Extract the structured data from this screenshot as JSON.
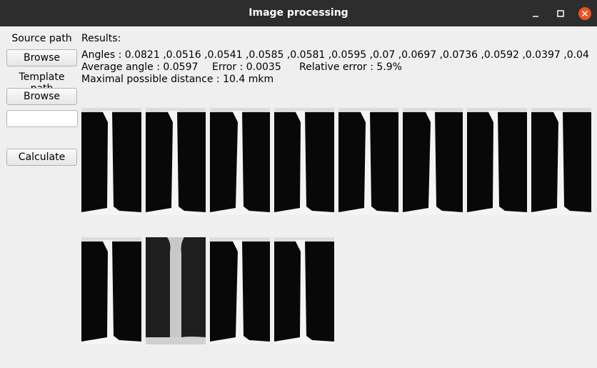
{
  "window": {
    "title": "Image processing",
    "controls": [
      "minimize-icon",
      "maximize-icon",
      "close-icon"
    ],
    "close_color": "#e95420"
  },
  "sidebar": {
    "source_label": "Source path",
    "source_button": "Browse",
    "template_label": "Template path",
    "template_button": "Browse",
    "path_value": "",
    "calculate_button": "Calculate"
  },
  "results": {
    "heading": "Results:",
    "angles": "Angles : 0.0821 ,0.0516 ,0.0541 ,0.0585 ,0.0581 ,0.0595 ,0.07 ,0.0697 ,0.0736 ,0.0592 ,0.0397 ,0.04",
    "average": "Average angle : 0.0597",
    "error": "Error : 0.0035",
    "relative_error": "Relative error : 5.9%",
    "max_distance": "Maximal possible distance : 10.4 mkm"
  },
  "images": {
    "count": 12,
    "items": [
      {
        "variant": "dark"
      },
      {
        "variant": "dark"
      },
      {
        "variant": "dark"
      },
      {
        "variant": "dark"
      },
      {
        "variant": "dark"
      },
      {
        "variant": "dark"
      },
      {
        "variant": "dark"
      },
      {
        "variant": "dark"
      },
      {
        "variant": "dark"
      },
      {
        "variant": "light"
      },
      {
        "variant": "dark"
      },
      {
        "variant": "dark"
      }
    ]
  }
}
